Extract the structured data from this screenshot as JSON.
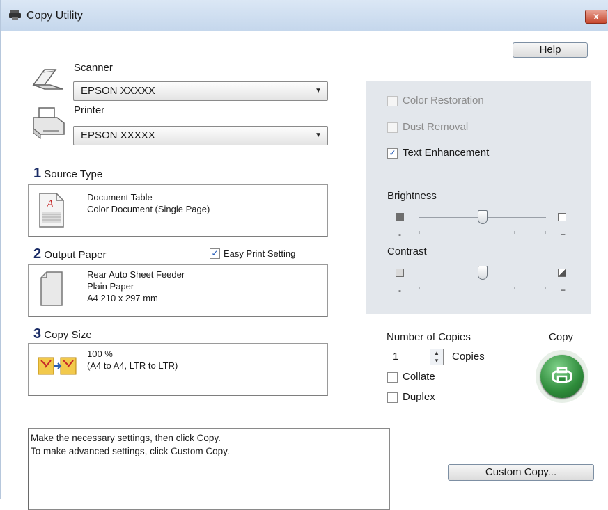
{
  "window": {
    "title": "Copy Utility",
    "close_label": "x"
  },
  "help_label": "Help",
  "scanner": {
    "label": "Scanner",
    "value": "EPSON XXXXX"
  },
  "printer": {
    "label": "Printer",
    "value": "EPSON XXXXX"
  },
  "source": {
    "num": "1",
    "title": "Source Type",
    "line1": "Document Table",
    "line2": "Color Document (Single Page)"
  },
  "output": {
    "num": "2",
    "title": "Output Paper",
    "easy_label": "Easy Print Setting",
    "easy_checked": true,
    "line1": "Rear Auto Sheet Feeder",
    "line2": "Plain Paper",
    "line3": "A4 210 x 297 mm"
  },
  "copysize": {
    "num": "3",
    "title": "Copy Size",
    "line1": "100 %",
    "line2": "(A4 to A4, LTR to LTR)"
  },
  "options": {
    "color_restoration": {
      "label": "Color Restoration",
      "checked": false,
      "enabled": false
    },
    "dust_removal": {
      "label": "Dust Removal",
      "checked": false,
      "enabled": false
    },
    "text_enhancement": {
      "label": "Text Enhancement",
      "checked": true,
      "enabled": true
    }
  },
  "brightness": {
    "label": "Brightness",
    "minus": "-",
    "plus": "+",
    "level": 0.5
  },
  "contrast": {
    "label": "Contrast",
    "minus": "-",
    "plus": "+",
    "level": 0.5
  },
  "copies": {
    "label": "Number of Copies",
    "value": "1",
    "unit": "Copies",
    "collate_label": "Collate",
    "collate_checked": false,
    "duplex_label": "Duplex",
    "duplex_checked": false
  },
  "copy_label": "Copy",
  "message": {
    "line1": "Make the necessary settings, then click Copy.",
    "line2": "To make advanced settings, click Custom Copy."
  },
  "custom_copy_label": "Custom Copy...",
  "colors": {
    "accent": "#1a2c66",
    "copy_button": "#2e8b3a",
    "panel": "#e3e7ec",
    "check": "#1f56b5"
  },
  "icons": [
    "printer-icon",
    "scanner-icon",
    "document-icon",
    "paper-icon",
    "copy-size-icon",
    "print-icon"
  ]
}
